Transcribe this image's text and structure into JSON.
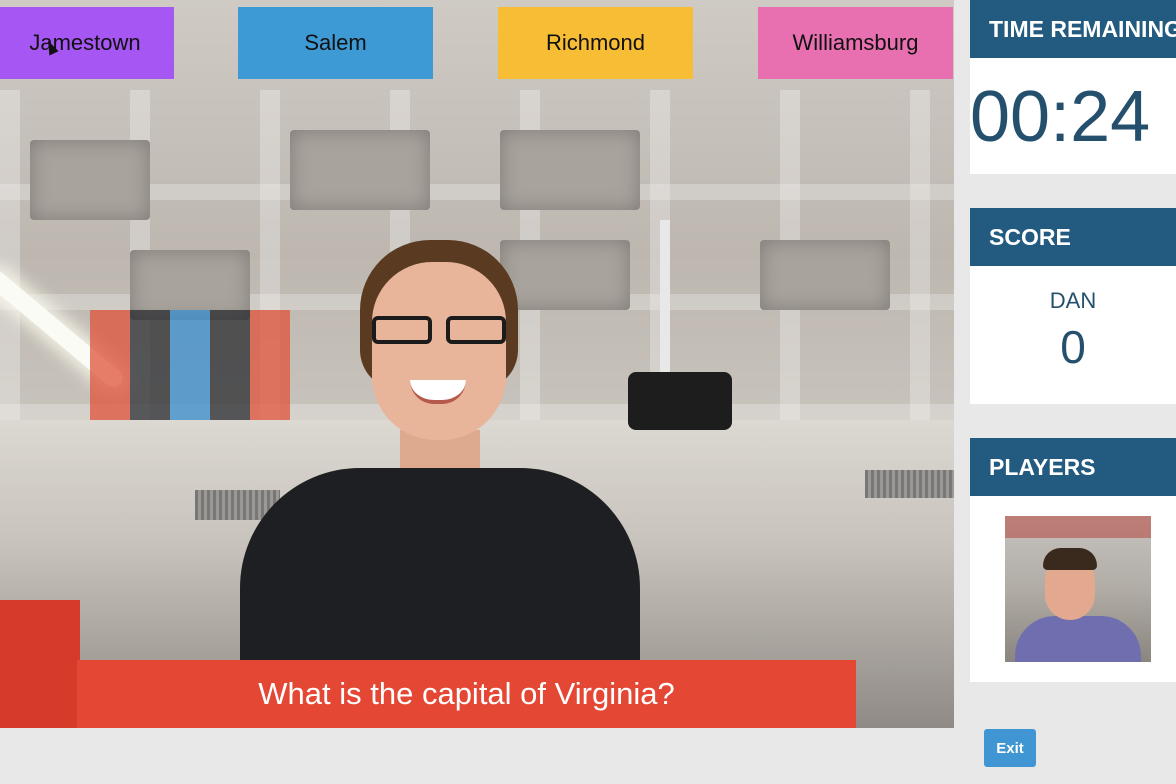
{
  "colors": {
    "panel_header": "#235b80",
    "question_bg": "#e54735",
    "exit_button": "#3f96d3",
    "answer_1": "#a656f2",
    "answer_2": "#3e9ad4",
    "answer_3": "#f7bd35",
    "answer_4": "#e86fb0"
  },
  "answers": [
    {
      "label": "Jamestown"
    },
    {
      "label": "Salem"
    },
    {
      "label": "Richmond"
    },
    {
      "label": "Williamsburg"
    }
  ],
  "question": "What is the capital of Virginia?",
  "timer": {
    "header": "TIME REMAINING",
    "value": "00:24"
  },
  "score": {
    "header": "SCORE",
    "player": "DAN",
    "value": "0"
  },
  "players": {
    "header": "PLAYERS"
  },
  "exit_label": "Exit"
}
